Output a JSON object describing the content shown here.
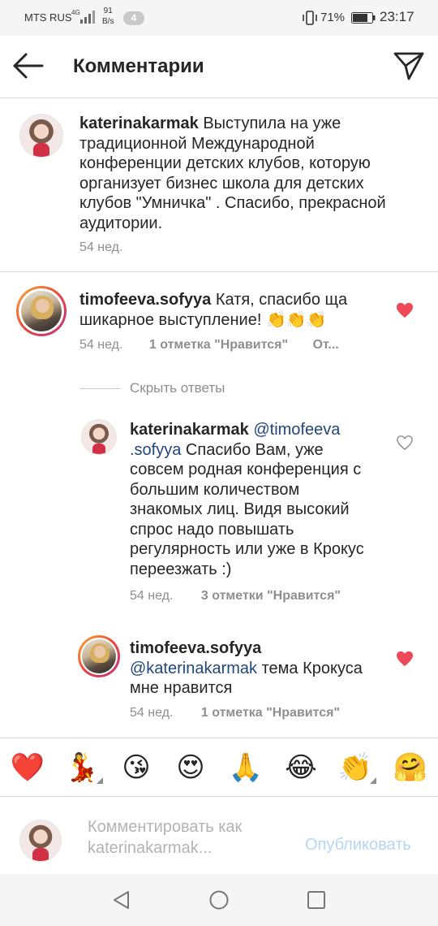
{
  "status_bar": {
    "carrier": "MTS RUS",
    "network": "4G",
    "speed_value": "91",
    "speed_unit": "B/s",
    "notification_count": "4",
    "battery_percent": "71%",
    "time": "23:17"
  },
  "header": {
    "title": "Комментарии",
    "back_icon": "arrow-left-icon",
    "send_icon": "paper-plane-icon"
  },
  "comments": [
    {
      "username": "katerinakarmak",
      "text": " Выступила на уже традиционной Международной конференции детских клубов, которую организует бизнес школа для детских клубов \"Умничка\" . Спасибо, прекрасной аудитории.",
      "time": "54 нед."
    },
    {
      "username": "timofeeva.sofyya",
      "text": " Катя, спасибо ща шикарное выступление! 👏👏👏",
      "time": "54 нед.",
      "likes": "1 отметка \"Нравится\"",
      "reply": "От...",
      "liked": true
    }
  ],
  "hide_replies": "Скрыть ответы",
  "replies": [
    {
      "username": "katerinakarmak",
      "mention": " @timofeeva .sofyya",
      "text": " Спасибо Вам, уже совсем родная конференция с большим количеством знакомых лиц. Видя высокий спрос надо повышать регулярность или уже в Крокус переезжать :)",
      "time": "54 нед.",
      "likes": "3 отметки \"Нравится\"",
      "liked": false
    },
    {
      "username": "timofeeva.sofyya",
      "mention": "@katerinakarmak",
      "text": " тема Крокуса мне нравится",
      "time": "54 нед.",
      "likes": "1 отметка \"Нравится\"",
      "liked": true
    }
  ],
  "emoji_bar": [
    "❤️",
    "💃",
    "😘",
    "😍",
    "🙏",
    "😂",
    "👏",
    "🤗"
  ],
  "input": {
    "placeholder": "Комментировать как katerinakarmak...",
    "publish_label": "Опубликовать"
  },
  "colors": {
    "heart_liked": "#ed4956",
    "mention": "#21477a",
    "publish_disabled": "#b3d7f5"
  }
}
